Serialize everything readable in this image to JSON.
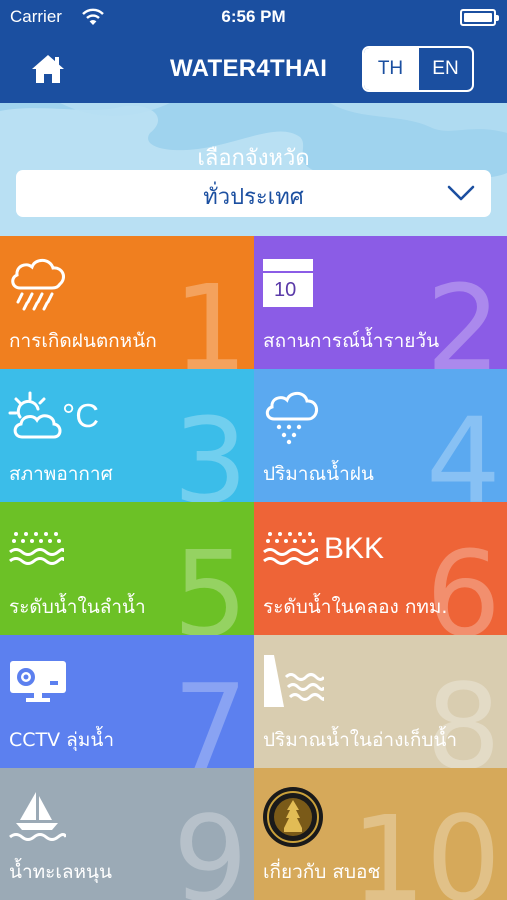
{
  "status_bar": {
    "carrier": "Carrier",
    "time": "6:56 PM"
  },
  "header": {
    "title": "WATER4THAI",
    "lang_th": "TH",
    "lang_en": "EN",
    "active_lang": "TH"
  },
  "province": {
    "label": "เลือกจังหวัด",
    "selected": "ทั่วประเทศ"
  },
  "tiles": [
    {
      "number": "1",
      "label": "การเกิดฝนตกหนัก",
      "color": "#f07f1f",
      "icon": "heavy-rain-cloud-icon"
    },
    {
      "number": "2",
      "label": "สถานการณ์น้ำรายวัน",
      "color": "#8b5ce6",
      "icon": "calendar-icon",
      "icon_text": "10"
    },
    {
      "number": "3",
      "label": "สภาพอากาศ",
      "color": "#3bbde9",
      "icon": "sun-cloud-icon",
      "icon_text": "°C"
    },
    {
      "number": "4",
      "label": "ปริมาณน้ำฝน",
      "color": "#5ba9f0",
      "icon": "rain-cloud-icon"
    },
    {
      "number": "5",
      "label": "ระดับน้ำในลำน้ำ",
      "color": "#6cc126",
      "icon": "river-level-icon"
    },
    {
      "number": "6",
      "label": "ระดับน้ำในคลอง กทม.",
      "color": "#ee6437",
      "icon": "canal-level-icon",
      "icon_text": "BKK"
    },
    {
      "number": "7",
      "label": "CCTV ลุ่มน้ำ",
      "color": "#5c80ef",
      "icon": "cctv-monitor-icon"
    },
    {
      "number": "8",
      "label": "ปริมาณน้ำในอ่างเก็บน้ำ",
      "color": "#d9cdb0",
      "icon": "dam-icon"
    },
    {
      "number": "9",
      "label": "น้ำทะเลหนุน",
      "color": "#9baab6",
      "icon": "sailboat-icon"
    },
    {
      "number": "10",
      "label": "เกี่ยวกับ สบอช",
      "color": "#d6a95a",
      "icon": "emblem-icon"
    }
  ]
}
